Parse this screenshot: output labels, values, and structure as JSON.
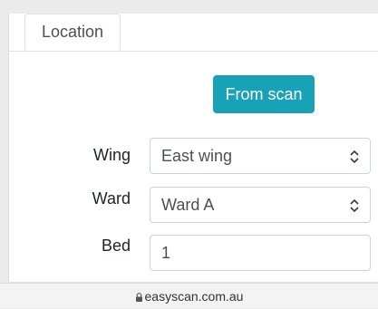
{
  "tabs": [
    {
      "label": "Location",
      "active": true
    }
  ],
  "scan_button": {
    "label": "From scan",
    "color": "#17a2b8"
  },
  "form": {
    "wing": {
      "label": "Wing",
      "value": "East wing",
      "icon": "updown-chevron-icon"
    },
    "ward": {
      "label": "Ward",
      "value": "Ward A",
      "icon": "updown-chevron-icon"
    },
    "bed": {
      "label": "Bed",
      "value": "1"
    }
  },
  "browser": {
    "url": "easyscan.com.au",
    "icon": "lock-icon"
  }
}
